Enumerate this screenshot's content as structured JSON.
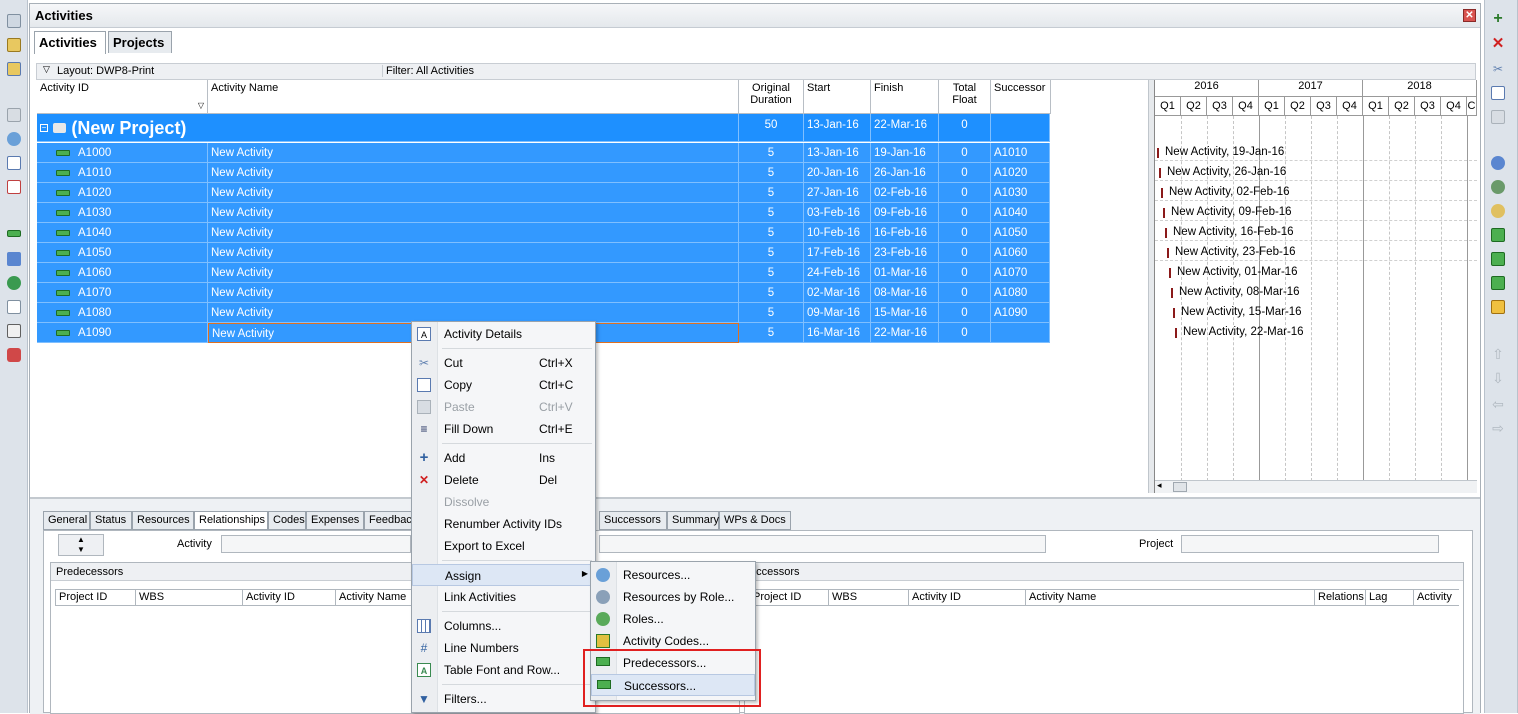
{
  "window": {
    "title": "Activities"
  },
  "tabs": [
    {
      "label": "Activities",
      "active": true
    },
    {
      "label": "Projects",
      "active": false
    }
  ],
  "layoutbar": {
    "layout": "Layout: DWP8-Print",
    "filter": "Filter: All Activities"
  },
  "columns": {
    "id": "Activity ID",
    "name": "Activity Name",
    "dur1": "Original",
    "dur2": "Duration",
    "start": "Start",
    "finish": "Finish",
    "float1": "Total",
    "float2": "Float",
    "succ": "Successor"
  },
  "project_row": {
    "name": "(New Project)",
    "duration": "50",
    "start": "13-Jan-16",
    "finish": "22-Mar-16",
    "float": "0"
  },
  "rows": [
    {
      "id": "A1000",
      "name": "New Activity",
      "dur": "5",
      "start": "13-Jan-16",
      "finish": "19-Jan-16",
      "float": "0",
      "succ": "A1010"
    },
    {
      "id": "A1010",
      "name": "New Activity",
      "dur": "5",
      "start": "20-Jan-16",
      "finish": "26-Jan-16",
      "float": "0",
      "succ": "A1020"
    },
    {
      "id": "A1020",
      "name": "New Activity",
      "dur": "5",
      "start": "27-Jan-16",
      "finish": "02-Feb-16",
      "float": "0",
      "succ": "A1030"
    },
    {
      "id": "A1030",
      "name": "New Activity",
      "dur": "5",
      "start": "03-Feb-16",
      "finish": "09-Feb-16",
      "float": "0",
      "succ": "A1040"
    },
    {
      "id": "A1040",
      "name": "New Activity",
      "dur": "5",
      "start": "10-Feb-16",
      "finish": "16-Feb-16",
      "float": "0",
      "succ": "A1050"
    },
    {
      "id": "A1050",
      "name": "New Activity",
      "dur": "5",
      "start": "17-Feb-16",
      "finish": "23-Feb-16",
      "float": "0",
      "succ": "A1060"
    },
    {
      "id": "A1060",
      "name": "New Activity",
      "dur": "5",
      "start": "24-Feb-16",
      "finish": "01-Mar-16",
      "float": "0",
      "succ": "A1070"
    },
    {
      "id": "A1070",
      "name": "New Activity",
      "dur": "5",
      "start": "02-Mar-16",
      "finish": "08-Mar-16",
      "float": "0",
      "succ": "A1080"
    },
    {
      "id": "A1080",
      "name": "New Activity",
      "dur": "5",
      "start": "09-Mar-16",
      "finish": "15-Mar-16",
      "float": "0",
      "succ": "A1090"
    },
    {
      "id": "A1090",
      "name": "New Activity",
      "dur": "5",
      "start": "16-Mar-16",
      "finish": "22-Mar-16",
      "float": "0",
      "succ": ""
    }
  ],
  "gantt": {
    "years": [
      "2016",
      "2017",
      "2018"
    ],
    "quarters": [
      "Q1",
      "Q2",
      "Q3",
      "Q4",
      "Q1",
      "Q2",
      "Q3",
      "Q4",
      "Q1",
      "Q2",
      "Q3",
      "Q4",
      "C"
    ],
    "labels": [
      "New Activity, 19-Jan-16",
      "New Activity, 26-Jan-16",
      "New Activity, 02-Feb-16",
      "New Activity, 09-Feb-16",
      "New Activity, 16-Feb-16",
      "New Activity, 23-Feb-16",
      "New Activity, 01-Mar-16",
      "New Activity, 08-Mar-16",
      "New Activity, 15-Mar-16",
      "New Activity, 22-Mar-16"
    ]
  },
  "bottom_tabs": [
    "General",
    "Status",
    "Resources",
    "Relationships",
    "Codes",
    "Expenses",
    "Feedbac",
    "Successors",
    "Summary",
    "WPs & Docs"
  ],
  "details": {
    "activity_label": "Activity",
    "project_label": "Project",
    "predecessors_title": "Predecessors",
    "successors_title": "uccessors",
    "pred_cols": [
      "Project ID",
      "WBS",
      "Activity ID",
      "Activity Name"
    ],
    "succ_cols": [
      "Project ID",
      "WBS",
      "Activity ID",
      "Activity Name",
      "Relations",
      "Lag",
      "Activity"
    ]
  },
  "context_menu": {
    "activity_details": "Activity Details",
    "cut": "Cut",
    "cut_sc": "Ctrl+X",
    "copy": "Copy",
    "copy_sc": "Ctrl+C",
    "paste": "Paste",
    "paste_sc": "Ctrl+V",
    "fill_down": "Fill Down",
    "fill_down_sc": "Ctrl+E",
    "add": "Add",
    "add_sc": "Ins",
    "delete": "Delete",
    "delete_sc": "Del",
    "dissolve": "Dissolve",
    "renumber": "Renumber Activity IDs",
    "export": "Export to Excel",
    "assign": "Assign",
    "link": "Link Activities",
    "columns": "Columns...",
    "line_numbers": "Line Numbers",
    "table_font": "Table Font and Row...",
    "filters": "Filters..."
  },
  "submenu": {
    "resources": "Resources...",
    "resources_by_role": "Resources by Role...",
    "roles": "Roles...",
    "activity_codes": "Activity Codes...",
    "predecessors": "Predecessors...",
    "successors": "Successors..."
  },
  "colors": {
    "selection": "#3399ff",
    "project_row": "#1e90ff",
    "highlight": "#e02020"
  }
}
